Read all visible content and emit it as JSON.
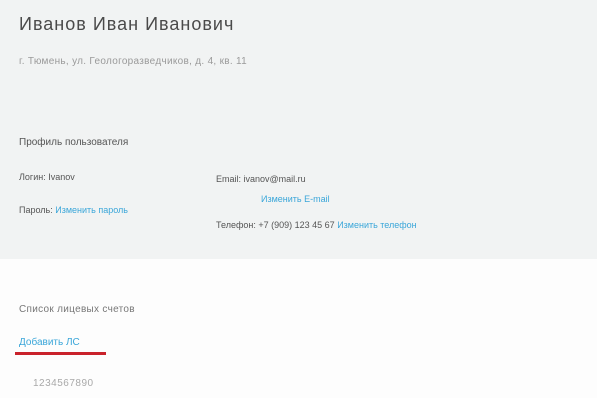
{
  "header": {
    "name": "Иванов Иван Иванович",
    "address": "г. Тюмень, ул. Геологоразведчиков, д. 4, кв. 11"
  },
  "profile": {
    "title": "Профиль пользователя",
    "login_label": "Логин:",
    "login_value": "Ivanov",
    "password_label": "Пароль:",
    "password_link": "Изменить пароль",
    "email_label": "Email:",
    "email_value": "ivanov@mail.ru",
    "email_link": "Изменить E-mail",
    "phone_label": "Телефон:",
    "phone_value": "+7 (909) 123 45 67",
    "phone_link": "Изменить телефон"
  },
  "accounts": {
    "title": "Список лицевых счетов",
    "add_link": "Добавить ЛС",
    "items": [
      "1234567890"
    ]
  },
  "colors": {
    "link": "#3aa6d9",
    "accent_underline": "#c9222b",
    "panel_bg": "#f1f3f3"
  }
}
